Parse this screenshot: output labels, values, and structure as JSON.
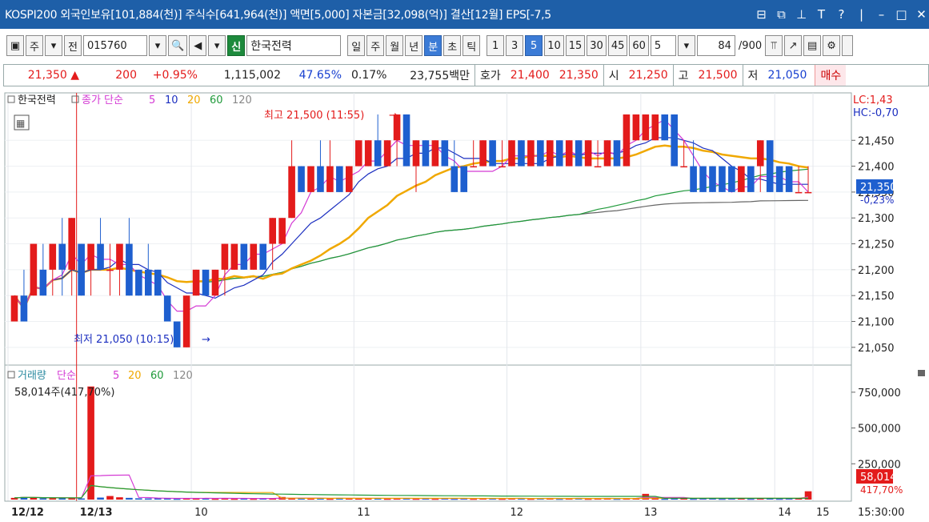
{
  "window": {
    "title": "KOSPI200 외국인보유[101,884(천)] 주식수[641,964(천)] 액면[5,000] 자본금[32,098(억)] 결산[12월] EPS[-7,5",
    "icons": [
      "window-tile-icon",
      "window-copy-icon",
      "pin-icon",
      "font-icon",
      "help-icon",
      "minimize-icon",
      "maximize-icon",
      "close-icon"
    ]
  },
  "toolbar": {
    "mode1": "주",
    "mode2": "전",
    "code": "015760",
    "new_badge": "신",
    "stock_name": "한국전력",
    "periods": [
      "일",
      "주",
      "월",
      "년",
      "분",
      "초",
      "틱"
    ],
    "active_period": "분",
    "intervals": [
      "1",
      "3",
      "5",
      "10",
      "15",
      "30",
      "45",
      "60"
    ],
    "active_interval": "5",
    "interval_select": "5",
    "count": "84",
    "count_total": "/900"
  },
  "quote": {
    "price": "21,350",
    "arrow": "▲",
    "change": "200",
    "change_pct": "+0.95%",
    "volume": "1,115,002",
    "ratio1": "47.65%",
    "ratio2": "0.17%",
    "amount": "23,755백만",
    "ask_label": "호가",
    "ask1": "21,400",
    "ask2": "21,350",
    "open_label": "시",
    "open": "21,250",
    "high_label": "고",
    "high": "21,500",
    "low_label": "저",
    "low": "21,050",
    "buy_label": "매수"
  },
  "chart": {
    "price_legend": {
      "name": "한국전력",
      "ma_label": "종가 단순",
      "ma": [
        "5",
        "10",
        "20",
        "60",
        "120"
      ]
    },
    "volume_legend": {
      "name": "거래량",
      "ma_label": "단순",
      "ma": [
        "5",
        "20",
        "60",
        "120"
      ]
    },
    "volume_readout": "58,014주(417,70%)",
    "lc": "LC:1,43",
    "hc": "HC:-0,70",
    "price_ticks": [
      "21,450",
      "21,400",
      "21,350",
      "21,300",
      "21,250",
      "21,200",
      "21,150",
      "21,100",
      "21,050"
    ],
    "current_price_label": "21,350",
    "current_pct_label": "-0,23%",
    "volume_ticks": [
      "750,000",
      "500,000",
      "250,000"
    ],
    "current_volume_label": "58,014",
    "current_volume_pct": "417,70%",
    "high_annotation": "최고 21,500 (11:55)",
    "low_annotation": "최저 21,050 (10:15)",
    "x_labels": [
      "12/12",
      "12/13",
      "10",
      "11",
      "12",
      "13",
      "14",
      "15"
    ],
    "time_label": "15:30:00",
    "colors": {
      "up": "#e31b1b",
      "down": "#1e5fcf",
      "ma5": "#d43ad4",
      "ma10": "#1c2fc0",
      "ma20": "#f0a800",
      "ma60": "#1f9a3a",
      "ma120": "#666666"
    }
  },
  "chart_data": {
    "type": "candlestick",
    "interval": "5분",
    "ohlc": [
      {
        "o": 21100,
        "h": 21150,
        "l": 21100,
        "c": 21150
      },
      {
        "o": 21150,
        "h": 21200,
        "l": 21100,
        "c": 21100
      },
      {
        "o": 21150,
        "h": 21250,
        "l": 21150,
        "c": 21250
      },
      {
        "o": 21200,
        "h": 21250,
        "l": 21150,
        "c": 21150
      },
      {
        "o": 21200,
        "h": 21250,
        "l": 21150,
        "c": 21250
      },
      {
        "o": 21250,
        "h": 21300,
        "l": 21150,
        "c": 21200
      },
      {
        "o": 21200,
        "h": 21300,
        "l": 21150,
        "c": 21300
      },
      {
        "o": 21250,
        "h": 21250,
        "l": 21150,
        "c": 21150
      },
      {
        "o": 21200,
        "h": 21250,
        "l": 21150,
        "c": 21250
      },
      {
        "o": 21250,
        "h": 21300,
        "l": 21200,
        "c": 21200
      },
      {
        "o": 21200,
        "h": 21250,
        "l": 21150,
        "c": 21200
      },
      {
        "o": 21200,
        "h": 21250,
        "l": 21150,
        "c": 21250
      },
      {
        "o": 21250,
        "h": 21300,
        "l": 21150,
        "c": 21150
      },
      {
        "o": 21200,
        "h": 21200,
        "l": 21150,
        "c": 21150
      },
      {
        "o": 21200,
        "h": 21250,
        "l": 21150,
        "c": 21150
      },
      {
        "o": 21200,
        "h": 21200,
        "l": 21150,
        "c": 21150
      },
      {
        "o": 21150,
        "h": 21150,
        "l": 21100,
        "c": 21100
      },
      {
        "o": 21100,
        "h": 21100,
        "l": 21050,
        "c": 21050
      },
      {
        "o": 21050,
        "h": 21150,
        "l": 21050,
        "c": 21150
      },
      {
        "o": 21150,
        "h": 21200,
        "l": 21150,
        "c": 21200
      },
      {
        "o": 21200,
        "h": 21200,
        "l": 21150,
        "c": 21150
      },
      {
        "o": 21150,
        "h": 21200,
        "l": 21150,
        "c": 21200
      },
      {
        "o": 21200,
        "h": 21250,
        "l": 21150,
        "c": 21250
      },
      {
        "o": 21200,
        "h": 21250,
        "l": 21200,
        "c": 21250
      },
      {
        "o": 21250,
        "h": 21250,
        "l": 21200,
        "c": 21200
      },
      {
        "o": 21200,
        "h": 21250,
        "l": 21200,
        "c": 21250
      },
      {
        "o": 21250,
        "h": 21250,
        "l": 21200,
        "c": 21200
      },
      {
        "o": 21250,
        "h": 21300,
        "l": 21200,
        "c": 21300
      },
      {
        "o": 21250,
        "h": 21300,
        "l": 21250,
        "c": 21300
      },
      {
        "o": 21300,
        "h": 21450,
        "l": 21300,
        "c": 21400
      },
      {
        "o": 21400,
        "h": 21400,
        "l": 21350,
        "c": 21350
      },
      {
        "o": 21350,
        "h": 21400,
        "l": 21350,
        "c": 21400
      },
      {
        "o": 21400,
        "h": 21450,
        "l": 21350,
        "c": 21350
      },
      {
        "o": 21350,
        "h": 21450,
        "l": 21350,
        "c": 21400
      },
      {
        "o": 21400,
        "h": 21400,
        "l": 21350,
        "c": 21350
      },
      {
        "o": 21350,
        "h": 21400,
        "l": 21350,
        "c": 21400
      },
      {
        "o": 21400,
        "h": 21450,
        "l": 21400,
        "c": 21450
      },
      {
        "o": 21400,
        "h": 21450,
        "l": 21400,
        "c": 21450
      },
      {
        "o": 21450,
        "h": 21500,
        "l": 21400,
        "c": 21400
      },
      {
        "o": 21400,
        "h": 21450,
        "l": 21400,
        "c": 21450
      },
      {
        "o": 21450,
        "h": 21500,
        "l": 21400,
        "c": 21500
      },
      {
        "o": 21500,
        "h": 21500,
        "l": 21400,
        "c": 21400
      },
      {
        "o": 21400,
        "h": 21450,
        "l": 21350,
        "c": 21450
      },
      {
        "o": 21450,
        "h": 21450,
        "l": 21400,
        "c": 21400
      },
      {
        "o": 21400,
        "h": 21450,
        "l": 21400,
        "c": 21450
      },
      {
        "o": 21450,
        "h": 21450,
        "l": 21400,
        "c": 21400
      },
      {
        "o": 21400,
        "h": 21450,
        "l": 21350,
        "c": 21350
      },
      {
        "o": 21400,
        "h": 21400,
        "l": 21350,
        "c": 21350
      },
      {
        "o": 21400,
        "h": 21450,
        "l": 21400,
        "c": 21400
      },
      {
        "o": 21400,
        "h": 21450,
        "l": 21400,
        "c": 21450
      },
      {
        "o": 21450,
        "h": 21450,
        "l": 21400,
        "c": 21400
      },
      {
        "o": 21400,
        "h": 21450,
        "l": 21400,
        "c": 21400
      },
      {
        "o": 21400,
        "h": 21450,
        "l": 21400,
        "c": 21450
      },
      {
        "o": 21450,
        "h": 21450,
        "l": 21400,
        "c": 21400
      },
      {
        "o": 21400,
        "h": 21450,
        "l": 21400,
        "c": 21450
      },
      {
        "o": 21450,
        "h": 21450,
        "l": 21400,
        "c": 21400
      },
      {
        "o": 21400,
        "h": 21450,
        "l": 21400,
        "c": 21450
      },
      {
        "o": 21450,
        "h": 21450,
        "l": 21400,
        "c": 21400
      },
      {
        "o": 21400,
        "h": 21450,
        "l": 21400,
        "c": 21450
      },
      {
        "o": 21450,
        "h": 21450,
        "l": 21400,
        "c": 21400
      },
      {
        "o": 21400,
        "h": 21450,
        "l": 21400,
        "c": 21450
      },
      {
        "o": 21400,
        "h": 21450,
        "l": 21400,
        "c": 21400
      },
      {
        "o": 21400,
        "h": 21450,
        "l": 21400,
        "c": 21450
      },
      {
        "o": 21450,
        "h": 21450,
        "l": 21400,
        "c": 21400
      },
      {
        "o": 21400,
        "h": 21500,
        "l": 21400,
        "c": 21500
      },
      {
        "o": 21450,
        "h": 21500,
        "l": 21450,
        "c": 21500
      },
      {
        "o": 21450,
        "h": 21500,
        "l": 21450,
        "c": 21500
      },
      {
        "o": 21450,
        "h": 21500,
        "l": 21450,
        "c": 21500
      },
      {
        "o": 21500,
        "h": 21500,
        "l": 21450,
        "c": 21450
      },
      {
        "o": 21500,
        "h": 21500,
        "l": 21400,
        "c": 21400
      },
      {
        "o": 21400,
        "h": 21450,
        "l": 21400,
        "c": 21400
      },
      {
        "o": 21400,
        "h": 21450,
        "l": 21350,
        "c": 21350
      },
      {
        "o": 21400,
        "h": 21400,
        "l": 21350,
        "c": 21350
      },
      {
        "o": 21400,
        "h": 21400,
        "l": 21350,
        "c": 21350
      },
      {
        "o": 21400,
        "h": 21400,
        "l": 21350,
        "c": 21350
      },
      {
        "o": 21400,
        "h": 21400,
        "l": 21350,
        "c": 21350
      },
      {
        "o": 21350,
        "h": 21400,
        "l": 21350,
        "c": 21400
      },
      {
        "o": 21400,
        "h": 21400,
        "l": 21350,
        "c": 21350
      },
      {
        "o": 21400,
        "h": 21450,
        "l": 21350,
        "c": 21450
      },
      {
        "o": 21450,
        "h": 21450,
        "l": 21350,
        "c": 21350
      },
      {
        "o": 21400,
        "h": 21400,
        "l": 21350,
        "c": 21350
      },
      {
        "o": 21400,
        "h": 21400,
        "l": 21350,
        "c": 21350
      },
      {
        "o": 21350,
        "h": 21400,
        "l": 21350,
        "c": 21350
      },
      {
        "o": 21350,
        "h": 21400,
        "l": 21350,
        "c": 21350
      }
    ],
    "volume": [
      12000,
      18000,
      15000,
      9000,
      10000,
      11000,
      12000,
      8000,
      790000,
      14000,
      25000,
      16000,
      12000,
      9000,
      8000,
      9000,
      10000,
      7000,
      9000,
      8000,
      11000,
      7000,
      9000,
      7000,
      8000,
      7000,
      9000,
      8000,
      18000,
      9000,
      10000,
      8000,
      9000,
      7000,
      12000,
      9000,
      8000,
      10000,
      9000,
      7000,
      8000,
      9000,
      7000,
      8000,
      7000,
      9000,
      7000,
      8000,
      7000,
      9000,
      8000,
      7000,
      9000,
      8000,
      7000,
      8000,
      9000,
      7000,
      8000,
      9000,
      7000,
      8000,
      9000,
      7000,
      8000,
      9000,
      40000,
      9000,
      7000,
      8000,
      9000,
      7000,
      8000,
      9000,
      7000,
      8000,
      9000,
      7000,
      8000,
      9000,
      7000,
      8000,
      9000,
      58014
    ],
    "ylim_price": [
      21025,
      21520
    ],
    "ylim_volume": [
      0,
      850000
    ]
  }
}
